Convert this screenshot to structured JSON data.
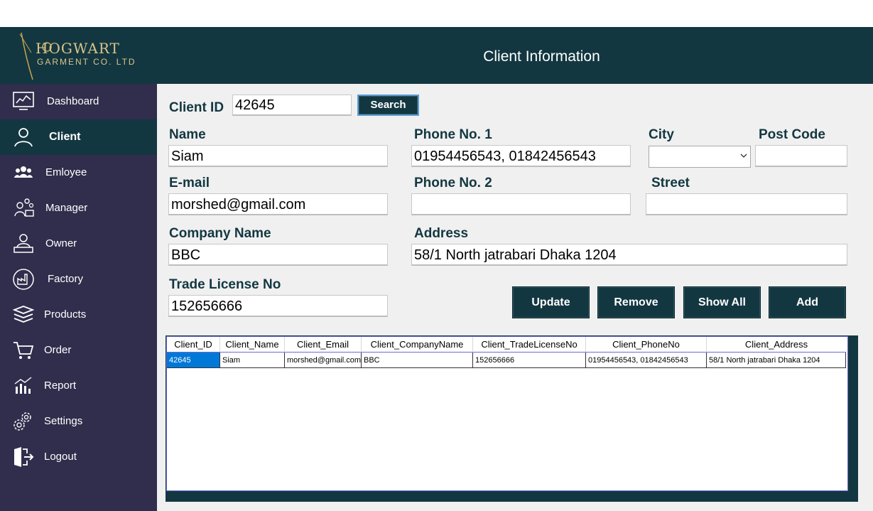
{
  "logo": {
    "line1": "HOGWART",
    "line2": "GARMENT CO. LTD"
  },
  "header": {
    "title": "Client Information"
  },
  "sidebar": {
    "items": [
      {
        "label": "Dashboard",
        "icon": "dashboard-icon"
      },
      {
        "label": "Client",
        "icon": "user-icon",
        "active": true
      },
      {
        "label": "Emloyee",
        "icon": "group-icon"
      },
      {
        "label": "Manager",
        "icon": "manager-icon"
      },
      {
        "label": "Owner",
        "icon": "owner-icon"
      },
      {
        "label": "Factory",
        "icon": "factory-icon"
      },
      {
        "label": "Products",
        "icon": "products-icon"
      },
      {
        "label": "Order",
        "icon": "cart-icon"
      },
      {
        "label": "Report",
        "icon": "report-icon"
      },
      {
        "label": "Settings",
        "icon": "gear-icon"
      },
      {
        "label": "Logout",
        "icon": "logout-icon"
      }
    ]
  },
  "form": {
    "client_id_label": "Client ID",
    "client_id_value": "42645",
    "search_label": "Search",
    "name_label": "Name",
    "name_value": "Siam",
    "phone1_label": "Phone No. 1",
    "phone1_value": "01954456543, 01842456543",
    "city_label": "City",
    "city_value": "",
    "postcode_label": "Post Code",
    "postcode_value": "",
    "email_label": "E-mail",
    "email_value": "morshed@gmail.com",
    "phone2_label": "Phone No. 2",
    "phone2_value": "",
    "street_label": "Street",
    "street_value": "",
    "company_label": "Company Name",
    "company_value": "BBC",
    "address_label": "Address",
    "address_value": "58/1 North jatrabari Dhaka 1204",
    "trade_label": "Trade License No",
    "trade_value": "152656666"
  },
  "actions": {
    "update": "Update",
    "remove": "Remove",
    "show_all": "Show All",
    "add": "Add"
  },
  "grid": {
    "columns": [
      "Client_ID",
      "Client_Name",
      "Client_Email",
      "Client_CompanyName",
      "Client_TradeLicenseNo",
      "Client_PhoneNo",
      "Client_Address"
    ],
    "rows": [
      [
        "42645",
        "Siam",
        "morshed@gmail.com",
        "BBC",
        "152656666",
        "01954456543, 01842456543",
        "58/1 North jatrabari Dhaka 1204"
      ]
    ]
  },
  "colors": {
    "sidebar": "#302e4c",
    "header": "#133741",
    "accent_text": "#133741",
    "selection": "#0078d7"
  }
}
